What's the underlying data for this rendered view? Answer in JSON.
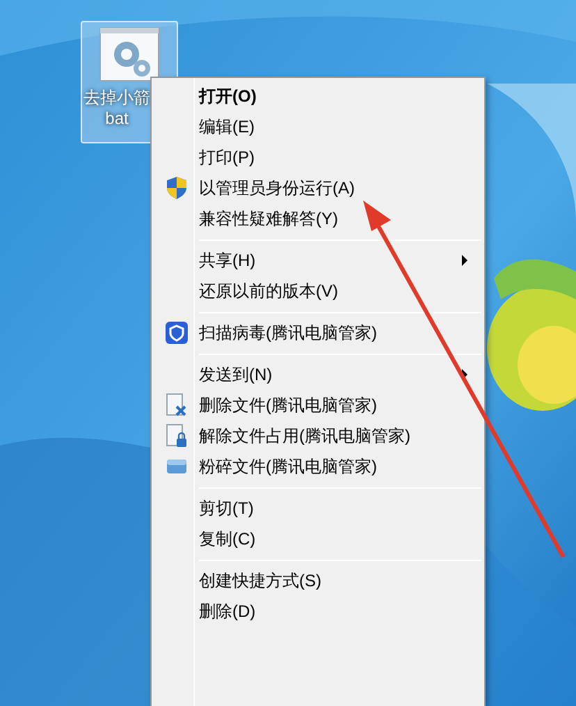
{
  "desktop_icon": {
    "name_line_1": "去掉小箭",
    "name_line_2": "bat",
    "selected": true
  },
  "context_menu": {
    "items": [
      {
        "kind": "item",
        "label": "打开(O)",
        "default": true,
        "submenu": false
      },
      {
        "kind": "item",
        "label": "编辑(E)",
        "default": false,
        "submenu": false
      },
      {
        "kind": "item",
        "label": "打印(P)",
        "default": false,
        "submenu": false
      },
      {
        "kind": "item",
        "label": "以管理员身份运行(A)",
        "default": false,
        "submenu": false
      },
      {
        "kind": "item",
        "label": "兼容性疑难解答(Y)",
        "default": false,
        "submenu": false
      },
      {
        "kind": "separator"
      },
      {
        "kind": "item",
        "label": "共享(H)",
        "default": false,
        "submenu": true
      },
      {
        "kind": "item",
        "label": "还原以前的版本(V)",
        "default": false,
        "submenu": false
      },
      {
        "kind": "separator"
      },
      {
        "kind": "item",
        "label": "扫描病毒(腾讯电脑管家)",
        "default": false,
        "submenu": false
      },
      {
        "kind": "separator"
      },
      {
        "kind": "item",
        "label": "发送到(N)",
        "default": false,
        "submenu": true
      },
      {
        "kind": "item",
        "label": "删除文件(腾讯电脑管家)",
        "default": false,
        "submenu": false
      },
      {
        "kind": "item",
        "label": "解除文件占用(腾讯电脑管家)",
        "default": false,
        "submenu": false
      },
      {
        "kind": "item",
        "label": "粉碎文件(腾讯电脑管家)",
        "default": false,
        "submenu": false
      },
      {
        "kind": "separator"
      },
      {
        "kind": "item",
        "label": "剪切(T)",
        "default": false,
        "submenu": false
      },
      {
        "kind": "item",
        "label": "复制(C)",
        "default": false,
        "submenu": false
      },
      {
        "kind": "separator"
      },
      {
        "kind": "item",
        "label": "创建快捷方式(S)",
        "default": false,
        "submenu": false
      },
      {
        "kind": "item",
        "label": "删除(D)",
        "default": false,
        "submenu": false
      }
    ]
  }
}
